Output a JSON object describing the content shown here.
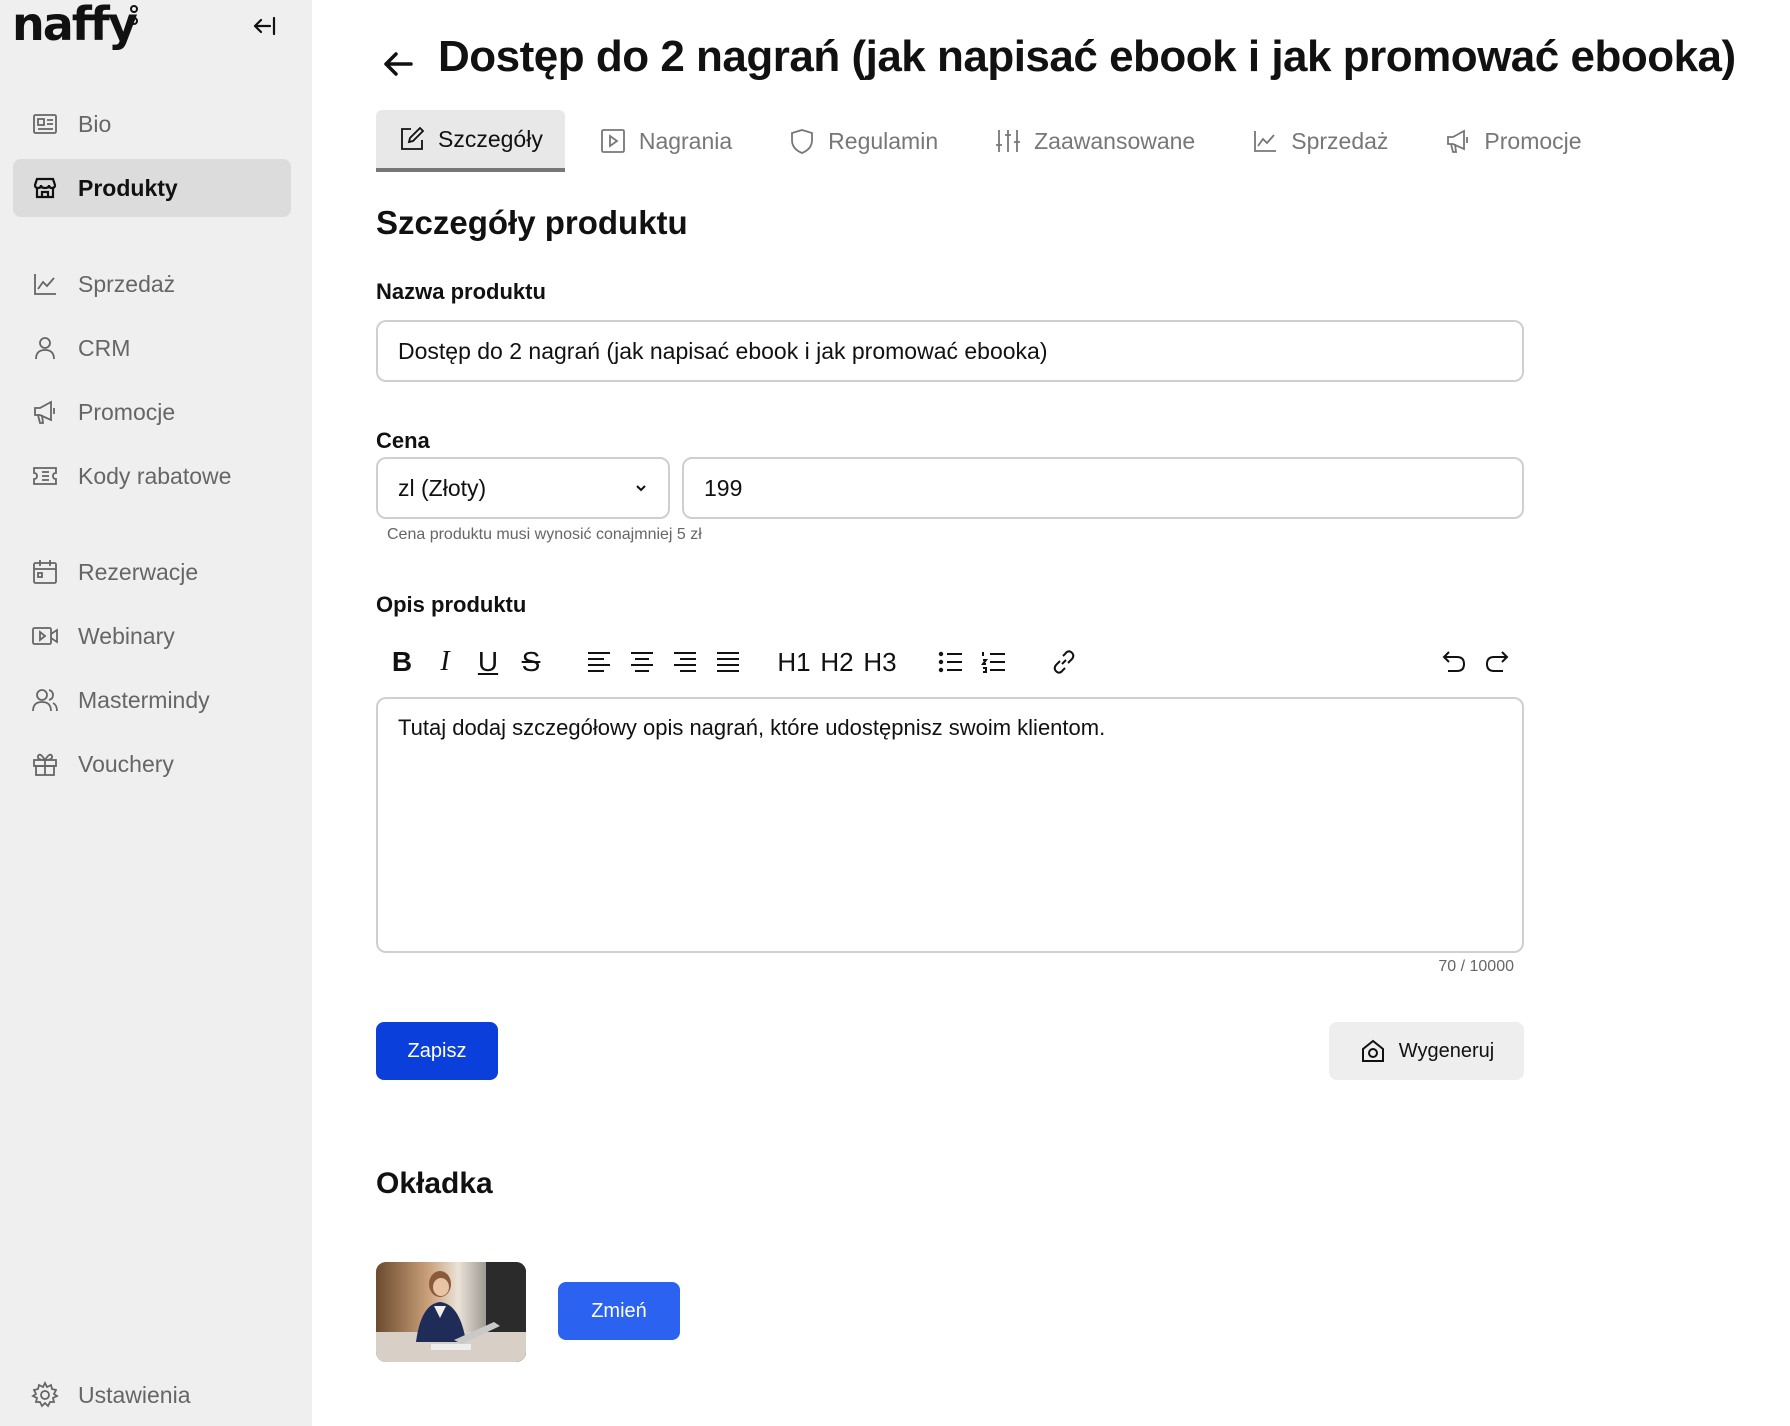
{
  "sidebar": {
    "logo": "naffy",
    "items": [
      {
        "label": "Bio",
        "icon": "id-card-icon",
        "active": false
      },
      {
        "label": "Produkty",
        "icon": "store-icon",
        "active": true
      },
      {
        "label": "Sprzedaż",
        "icon": "chart-icon",
        "active": false
      },
      {
        "label": "CRM",
        "icon": "user-icon",
        "active": false
      },
      {
        "label": "Promocje",
        "icon": "megaphone-icon",
        "active": false
      },
      {
        "label": "Kody rabatowe",
        "icon": "ticket-icon",
        "active": false
      },
      {
        "label": "Rezerwacje",
        "icon": "calendar-icon",
        "active": false
      },
      {
        "label": "Webinary",
        "icon": "video-icon",
        "active": false
      },
      {
        "label": "Mastermindy",
        "icon": "users-icon",
        "active": false
      },
      {
        "label": "Vouchery",
        "icon": "gift-icon",
        "active": false
      }
    ],
    "settings_label": "Ustawienia"
  },
  "header": {
    "title": "Dostęp do 2 nagrań (jak napisać ebook i jak promować ebooka)"
  },
  "tabs": [
    {
      "label": "Szczegóły",
      "icon": "edit-icon",
      "active": true
    },
    {
      "label": "Nagrania",
      "icon": "play-icon",
      "active": false
    },
    {
      "label": "Regulamin",
      "icon": "shield-icon",
      "active": false
    },
    {
      "label": "Zaawansowane",
      "icon": "sliders-icon",
      "active": false
    },
    {
      "label": "Sprzedaż",
      "icon": "chart-icon",
      "active": false
    },
    {
      "label": "Promocje",
      "icon": "megaphone-icon",
      "active": false
    }
  ],
  "details": {
    "section_title": "Szczegóły produktu",
    "name_label": "Nazwa produktu",
    "name_value": "Dostęp do 2 nagrań (jak napisać ebook i jak promować ebooka)",
    "price_label": "Cena",
    "currency_value": "zl (Złoty)",
    "price_value": "199",
    "price_hint": "Cena produktu musi wynosić conajmniej 5 zł",
    "description_label": "Opis produktu",
    "description_value": "Tutaj dodaj szczegółowy opis nagrań, które udostępnisz swoim klientom.",
    "char_counter": "70 / 10000",
    "save_label": "Zapisz",
    "generate_label": "Wygeneruj"
  },
  "toolbar": {
    "bold": "B",
    "italic": "I",
    "underline": "U",
    "strike": "S",
    "h1": "H1",
    "h2": "H2",
    "h3": "H3"
  },
  "cover": {
    "section_title": "Okładka",
    "change_label": "Zmień"
  },
  "colors": {
    "primary": "#0b3fdb",
    "secondary_button": "#2b62f0",
    "sidebar_bg": "#efefef",
    "active_nav": "#dcdcdc"
  }
}
